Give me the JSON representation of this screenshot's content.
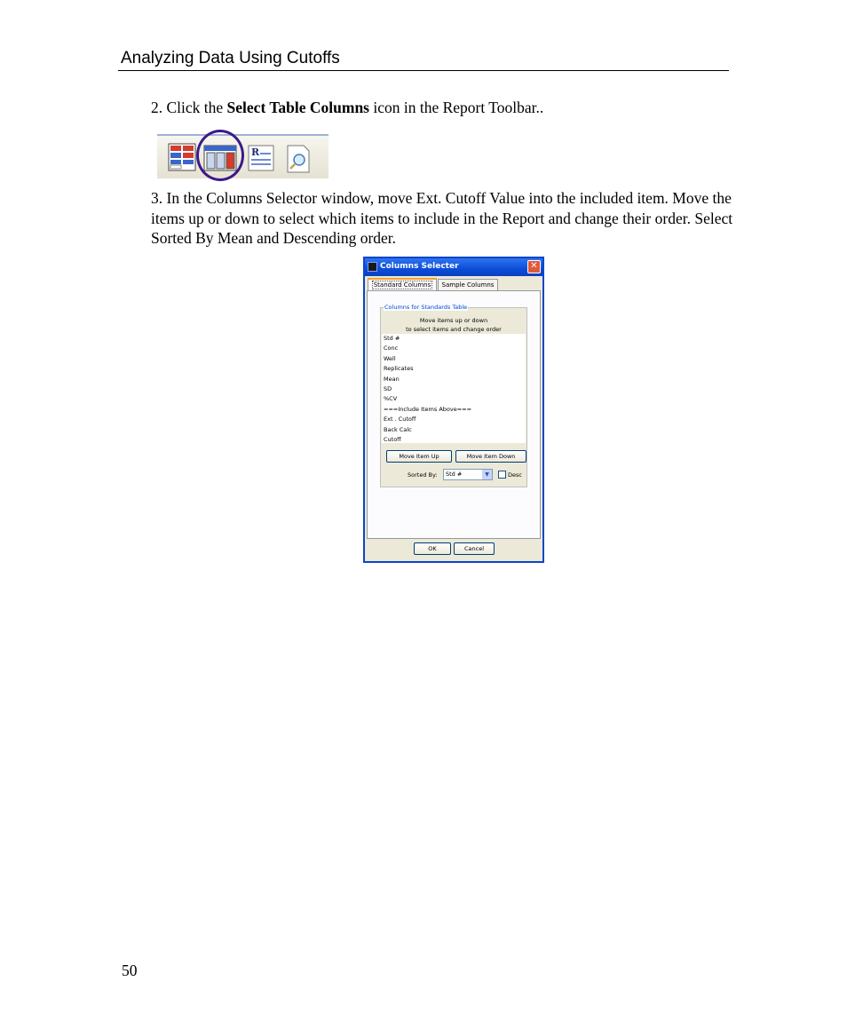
{
  "header": {
    "title": "Analyzing Data Using Cutoffs"
  },
  "steps": {
    "step2": {
      "prefix": "2. Click the ",
      "bold": "Select Table Columns",
      "suffix": " icon in the Report Toolbar.."
    },
    "step3": {
      "text": "3. In the Columns Selector window, move Ext. Cutoff Value into the included item. Move the items up or down to select which items to include in the Report and change their order. Select Sorted By Mean and Descending order."
    }
  },
  "toolbar": {
    "icons": [
      "table-grid-icon",
      "select-table-columns-icon",
      "report-icon",
      "print-preview-icon"
    ],
    "highlight_color": "#3a1a8a"
  },
  "dialog": {
    "title": "Columns Selecter",
    "tabs": [
      "Standard Columns",
      "Sample Columns"
    ],
    "group_title": "Columns for Standards Table",
    "hint_line1": "Move items up or down",
    "hint_line2": "to select items and change order",
    "items": [
      "Std #",
      "Conc",
      "Well",
      "Replicates",
      "Mean",
      "SD",
      "%CV",
      "===Include Items Above===",
      "Ext . Cutoff",
      "Back Calc",
      "Cutoff"
    ],
    "move_up_label": "Move Item Up",
    "move_down_label": "Move Item Down",
    "sorted_by_label": "Sorted By:",
    "sorted_by_value": "Std #",
    "desc_label": "Desc",
    "ok_label": "OK",
    "cancel_label": "Cancel"
  },
  "footer": {
    "page_number": "50"
  }
}
